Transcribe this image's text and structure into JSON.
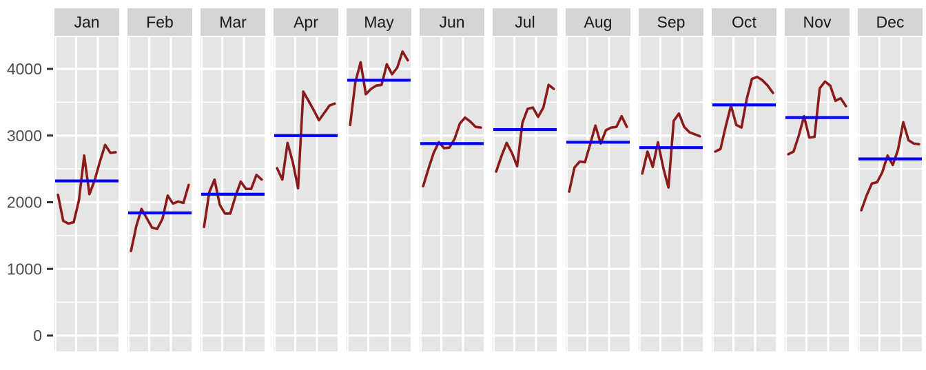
{
  "chart_data": {
    "type": "line",
    "title": "",
    "subtitle": "",
    "xlabel": "",
    "ylabel": "",
    "facet_by": "month",
    "grid": true,
    "legend": "none",
    "ylim": [
      0,
      4600
    ],
    "y_ticks": [
      0,
      1000,
      2000,
      3000,
      4000
    ],
    "y_tick_labels": [
      "0",
      "1000",
      "2000",
      "3000",
      "4000"
    ],
    "x_ticks_visible": false,
    "theme": {
      "panel_background": "#E5E5E5",
      "strip_background": "#D5D5D5",
      "gridline_color": "#FFFFFF",
      "plot_background": "#FFFFFF",
      "axis_text_color": "#4D4D4D",
      "strip_text_color": "#1A1A1A",
      "series_color": "#8B1A1A",
      "mean_line_color": "#0000FF"
    },
    "series": [
      {
        "name": "Jan",
        "color": "#8B1A1A",
        "mean": 2320,
        "values": [
          2110,
          1720,
          1680,
          1700,
          2030,
          2700,
          2120,
          2330,
          2610,
          2860,
          2740,
          2750
        ]
      },
      {
        "name": "Feb",
        "color": "#8B1A1A",
        "mean": 1840,
        "values": [
          1270,
          1640,
          1900,
          1760,
          1620,
          1600,
          1750,
          2100,
          1980,
          2010,
          1990,
          2260
        ]
      },
      {
        "name": "Mar",
        "color": "#8B1A1A",
        "mean": 2120,
        "values": [
          1630,
          2150,
          2340,
          1960,
          1830,
          1830,
          2090,
          2310,
          2200,
          2200,
          2410,
          2340
        ]
      },
      {
        "name": "Apr",
        "color": "#8B1A1A",
        "mean": 3000,
        "values": [
          2510,
          2340,
          2890,
          2600,
          2210,
          3660,
          3520,
          3380,
          3230,
          3340,
          3450,
          3480
        ]
      },
      {
        "name": "May",
        "color": "#8B1A1A",
        "mean": 3830,
        "values": [
          3160,
          3800,
          4100,
          3620,
          3700,
          3750,
          3760,
          4070,
          3920,
          4020,
          4260,
          4130
        ]
      },
      {
        "name": "Jun",
        "color": "#8B1A1A",
        "mean": 2880,
        "values": [
          2240,
          2500,
          2740,
          2900,
          2810,
          2820,
          2950,
          3180,
          3270,
          3210,
          3130,
          3120
        ]
      },
      {
        "name": "Jul",
        "color": "#8B1A1A",
        "mean": 3090,
        "values": [
          2460,
          2690,
          2890,
          2740,
          2540,
          3190,
          3400,
          3420,
          3280,
          3420,
          3760,
          3700
        ]
      },
      {
        "name": "Aug",
        "color": "#8B1A1A",
        "mean": 2900,
        "values": [
          2160,
          2520,
          2610,
          2600,
          2870,
          3150,
          2880,
          3080,
          3120,
          3130,
          3290,
          3130
        ]
      },
      {
        "name": "Sep",
        "color": "#8B1A1A",
        "mean": 2820,
        "values": [
          2430,
          2760,
          2530,
          2900,
          2520,
          2220,
          3220,
          3330,
          3130,
          3050,
          3020,
          2990
        ]
      },
      {
        "name": "Oct",
        "color": "#8B1A1A",
        "mean": 3460,
        "values": [
          2760,
          2800,
          3140,
          3450,
          3160,
          3120,
          3550,
          3850,
          3880,
          3830,
          3750,
          3640
        ]
      },
      {
        "name": "Nov",
        "color": "#8B1A1A",
        "mean": 3270,
        "values": [
          2720,
          2760,
          3000,
          3290,
          2970,
          2980,
          3710,
          3810,
          3750,
          3520,
          3560,
          3440
        ]
      },
      {
        "name": "Dec",
        "color": "#8B1A1A",
        "mean": 2650,
        "values": [
          1880,
          2100,
          2280,
          2300,
          2450,
          2700,
          2560,
          2790,
          3200,
          2930,
          2880,
          2870
        ]
      }
    ]
  },
  "facet_labels": [
    "Jan",
    "Feb",
    "Mar",
    "Apr",
    "May",
    "Jun",
    "Jul",
    "Aug",
    "Sep",
    "Oct",
    "Nov",
    "Dec"
  ]
}
